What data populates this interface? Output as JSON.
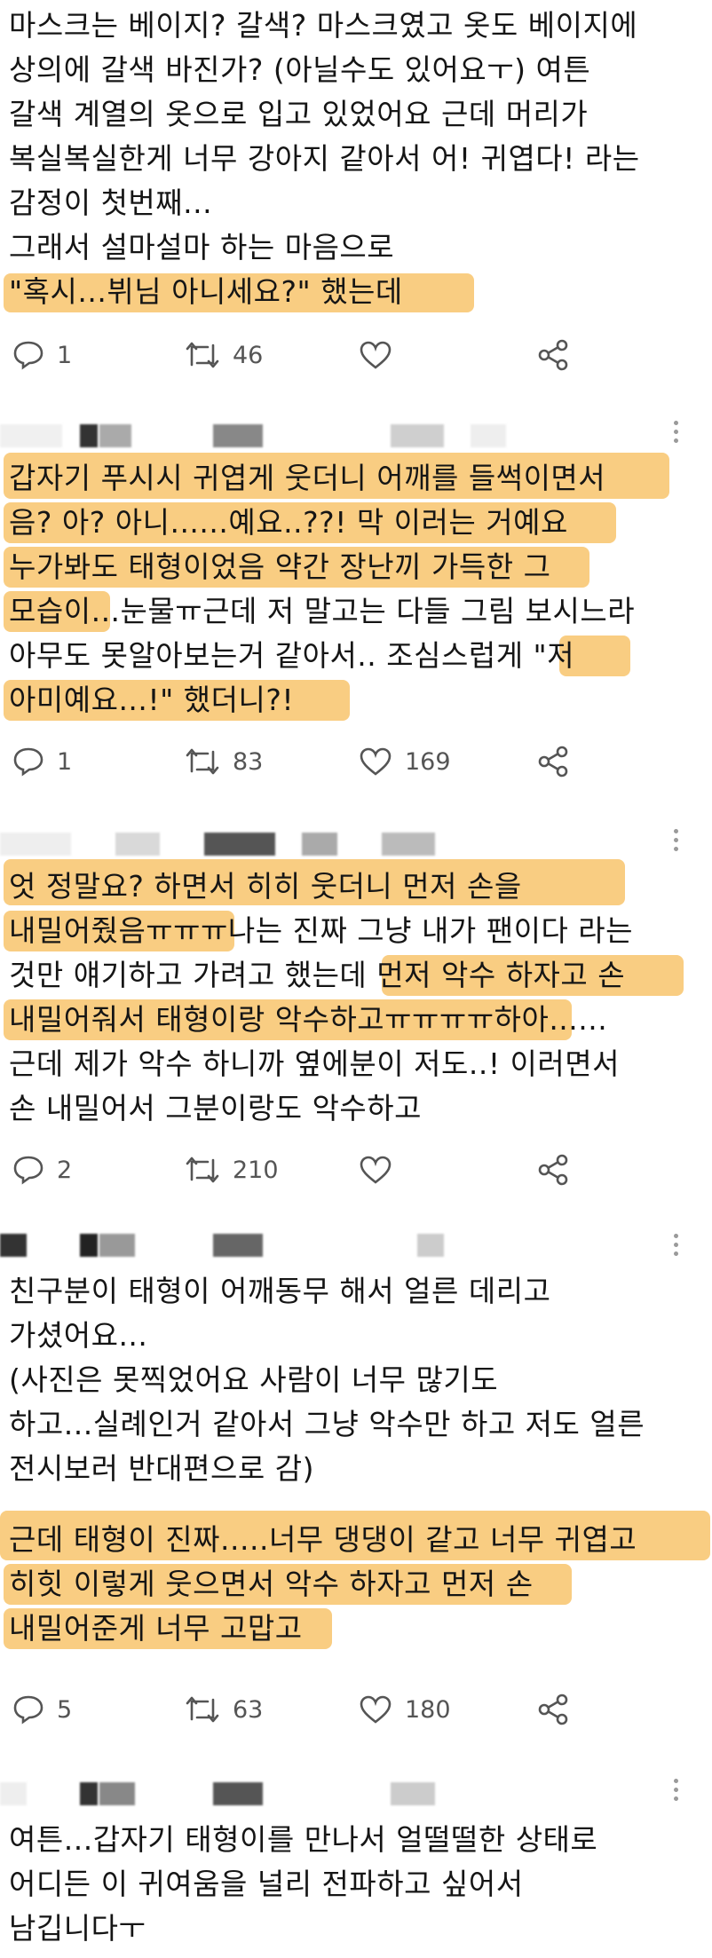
{
  "colors": {
    "highlight": "#f7bf5f",
    "icon": "#555555",
    "text": "#151515"
  },
  "tweets": [
    {
      "lines": [
        "마스크는 베이지? 갈색? 마스크였고 옷도 베이지에",
        "상의에 갈색 바진가? (아닐수도 있어요ㅜ) 여튼",
        "갈색 계열의 옷으로 입고 있었어요 근데 머리가",
        "복실복실한게 너무 강아지 같아서 어! 귀엽다! 라는",
        "감정이 첫번째...",
        "그래서 설마설마 하는 마음으로",
        "\"혹시...뷔님 아니세요?\" 했는데"
      ],
      "actions": {
        "reply": "1",
        "retweet": "46",
        "like": ""
      }
    },
    {
      "lines": [
        "갑자기 푸시시 귀엽게 웃더니 어깨를 들썩이면서",
        "음? 아? 아니......예요..??! 막 이러는 거예요",
        "누가봐도 태형이었음 약간 장난끼 가득한 그",
        "모습이...눈물ㅠ근데 저 말고는 다들 그림 보시느라",
        "아무도 못알아보는거 같아서.. 조심스럽게 \"저",
        "아미예요...!\" 했더니?!"
      ],
      "actions": {
        "reply": "1",
        "retweet": "83",
        "like": "169"
      }
    },
    {
      "lines": [
        "엇 정말요? 하면서 히히 웃더니 먼저 손을",
        "내밀어줬음ㅠㅠㅠ나는 진짜 그냥 내가 팬이다 라는",
        "것만 얘기하고 가려고 했는데 먼저 악수 하자고 손",
        "내밀어줘서 태형이랑 악수하고ㅠㅠㅠㅠ하아......",
        "근데 제가 악수 하니까 옆에분이 저도..! 이러면서",
        "손 내밀어서 그분이랑도 악수하고"
      ],
      "actions": {
        "reply": "2",
        "retweet": "210",
        "like": ""
      }
    },
    {
      "lines": [
        "친구분이 태형이 어깨동무 해서 얼른 데리고",
        "가셨어요...",
        "(사진은 못찍었어요 사람이 너무 많기도",
        "하고...실례인거 같아서 그냥 악수만 하고 저도 얼른",
        "전시보러 반대편으로 감)",
        "",
        "근데 태형이 진짜.....너무 댕댕이 같고 너무 귀엽고",
        "히힛 이렇게 웃으면서 악수 하자고 먼저 손",
        "내밀어준게 너무 고맙고"
      ],
      "actions": {
        "reply": "5",
        "retweet": "63",
        "like": "180"
      }
    },
    {
      "lines": [
        "여튼...갑자기 태형이를 만나서 얼떨떨한 상태로",
        "어디든 이 귀여움을 널리 전파하고 싶어서",
        "남깁니다ㅜ"
      ]
    }
  ]
}
